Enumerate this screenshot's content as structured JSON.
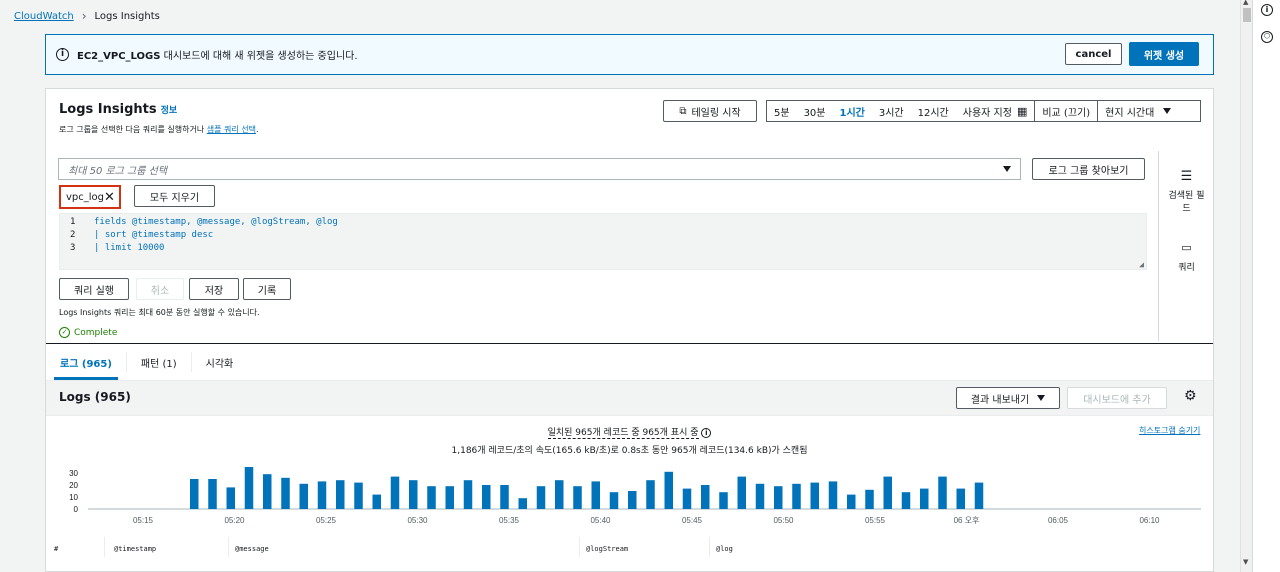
{
  "breadcrumb": {
    "root": "CloudWatch",
    "current": "Logs Insights"
  },
  "flash": {
    "bold": "EC2_VPC_LOGS",
    "text": " 대시보드에 대해 새 위젯을 생성하는 중입니다.",
    "cancel": "cancel",
    "create": "위젯 생성"
  },
  "panel": {
    "title": "Logs Insights",
    "info": "정보",
    "desc_prefix": "로그 그룹을 선택한 다음 쿼리를 실행하거나 ",
    "desc_link": "샘플 쿼리 선택",
    "desc_suffix": ".",
    "tail_button": "테일링 시작",
    "ranges": [
      "5분",
      "30분",
      "1시간",
      "3시간",
      "12시간",
      "사용자 지정"
    ],
    "active_range": "1시간",
    "compare": "비교 (끄기)",
    "timezone": "현지 시간대",
    "log_group_placeholder": "최대 50 로그 그룹 선택",
    "browse": "로그 그룹 찾아보기",
    "token": "vpc_log",
    "clear_all": "모두 지우기",
    "query_lines": [
      "fields @timestamp, @message, @logStream, @log",
      "| sort @timestamp desc",
      "| limit 10000"
    ],
    "run": "쿼리 실행",
    "cancel": "취소",
    "save": "저장",
    "history": "기록",
    "limit_note": "Logs Insights 쿼리는 최대 60분 동안 실행할 수 있습니다.",
    "status": "Complete",
    "side_fields": "검색된 필드",
    "side_query": "쿼리"
  },
  "tabs": [
    "로그 (965)",
    "패턴 (1)",
    "시각화"
  ],
  "logs": {
    "title": "Logs (965)",
    "export": "결과 내보내기",
    "add_dashboard": "대시보드에 추가",
    "matched": "일치된 965개 레코드 중 965개 표시 중",
    "scan": "1,186개 레코드/초의 속도(165.6 kB/초)로 0.8s초 동안 965개 레코드(134.6 kB)가 스캔됨",
    "hide_hist": "히스토그램 숨기기",
    "columns": [
      "#",
      "@timestamp",
      "@message",
      "@logStream",
      "@log"
    ]
  },
  "chart_data": {
    "type": "bar",
    "x_tick_labels": [
      "05:15",
      "05:20",
      "05:25",
      "05:30",
      "05:35",
      "05:40",
      "05:45",
      "05:50",
      "05:55",
      "06 오후",
      "06:05",
      "06:10"
    ],
    "y_ticks": [
      0,
      10,
      20,
      30
    ],
    "ylim": [
      0,
      35
    ],
    "values": [
      25,
      25,
      18,
      35,
      29,
      26,
      21,
      23,
      24,
      22,
      12,
      27,
      24,
      19,
      19,
      24,
      20,
      20,
      9,
      19,
      24,
      19,
      23,
      14,
      15,
      24,
      31,
      17,
      20,
      14,
      27,
      21,
      19,
      21,
      22,
      23,
      12,
      16,
      27,
      14,
      17,
      27,
      17,
      22
    ],
    "color": "#0073bb"
  }
}
